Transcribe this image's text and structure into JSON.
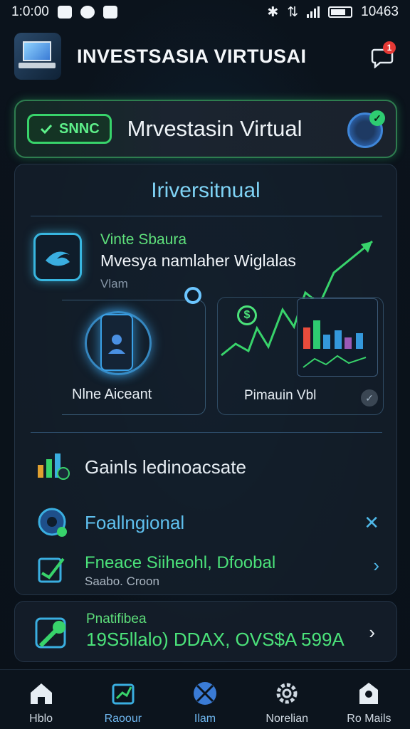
{
  "status_bar": {
    "time": "1:0:00",
    "right_text": "10463"
  },
  "header": {
    "title": "INVESTSASIA VIRTUSAI",
    "notification_count": "1"
  },
  "banner": {
    "pill": "SNNC",
    "title": "Mrvestasin Virtual"
  },
  "main": {
    "section_title": "Iriversitnual",
    "feature": {
      "subtitle": "Vinte Sbaura",
      "title": "Mvesya namlaher Wiglalas",
      "small": "Vlam"
    },
    "left_panel_label": "Nlne Aiceant",
    "right_panel_label": "Pimauin Vbl",
    "rows": [
      {
        "title": "Gainls ledinoacsate",
        "color": "#e6edf3"
      },
      {
        "title": "Foallngional",
        "color": "#5fc0ee",
        "action": "✕"
      },
      {
        "title": "Fneace Siiheohl, Dfoobal",
        "subtitle": "Saabo. Croon",
        "color": "#4be27a",
        "action": "›"
      }
    ]
  },
  "bottom_card": {
    "subtitle": "Pnatifibea",
    "title": "19S5llalo) DDAX, OVS$A 599A",
    "action": "›"
  },
  "nav": [
    {
      "label": "Hblo",
      "icon": "home-icon"
    },
    {
      "label": "Raoour",
      "icon": "wallet-icon"
    },
    {
      "label": "Ilam",
      "icon": "globe-icon"
    },
    {
      "label": "Norelian",
      "icon": "gear-icon"
    },
    {
      "label": "Ro Mails",
      "icon": "profile-icon"
    }
  ]
}
